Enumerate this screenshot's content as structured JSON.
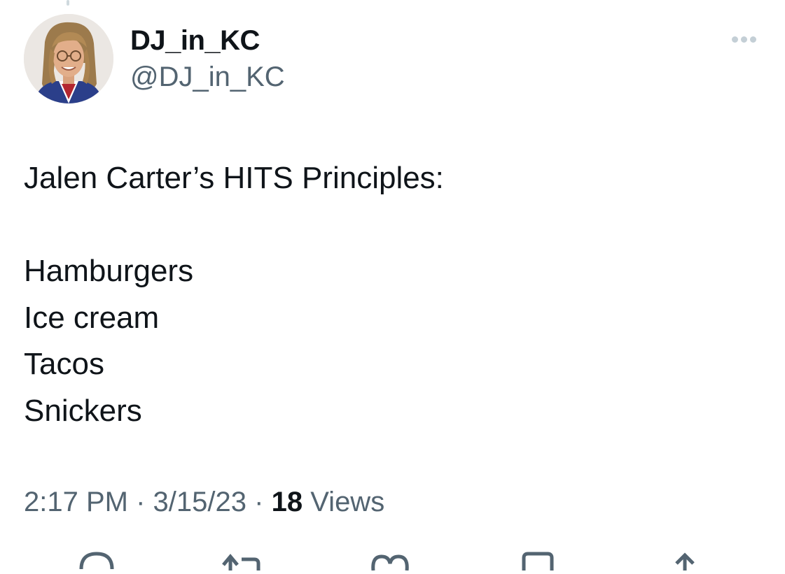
{
  "author": {
    "display_name": "DJ_in_KC",
    "handle": "@DJ_in_KC",
    "avatar_icon": "profile-photo"
  },
  "more_icon": "more-horizontal-icon",
  "tweet": {
    "title_line": "Jalen Carter’s HITS Principles:",
    "items": [
      "Hamburgers",
      "Ice cream",
      "Tacos",
      "Snickers"
    ]
  },
  "meta": {
    "time": "2:17 PM",
    "separator": "·",
    "date": "3/15/23",
    "views_count": "18",
    "views_label": "Views"
  },
  "actions": [
    {
      "name": "reply-icon"
    },
    {
      "name": "retweet-icon"
    },
    {
      "name": "like-icon"
    },
    {
      "name": "bookmark-icon"
    },
    {
      "name": "share-icon"
    }
  ],
  "colors": {
    "text_primary": "#0f1419",
    "text_secondary": "#536471",
    "icon_muted": "#c4cfd6"
  }
}
